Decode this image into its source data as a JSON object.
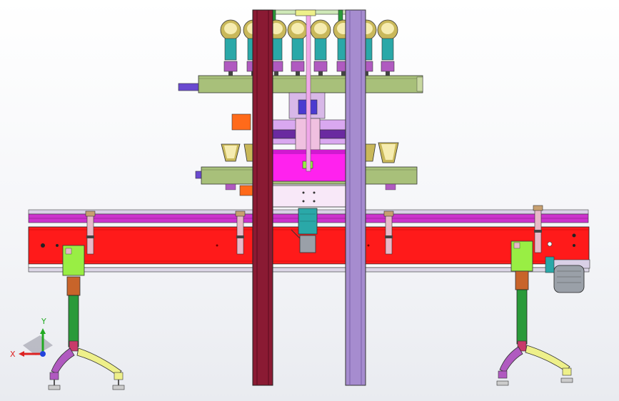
{
  "viewport": {
    "background": "#f4f5f8",
    "colors": {
      "conveyor_red": "#ff1a1a",
      "rail_magenta": "#cc33cc",
      "column_maroon": "#8a1a33",
      "column_purple": "#a68ccf",
      "bracket_olive": "#a8c07a",
      "leg_green": "#2a9a3a",
      "leg_copper": "#c8642a",
      "foot_magenta": "#b05ac0",
      "foot_yellow": "#eef08a",
      "block_green": "#99ee44",
      "panel_magenta": "#ff22ee",
      "motor_teal": "#2aa8a8",
      "cup_gold": "#c9b85a",
      "ram_orange": "#ff6a1a"
    }
  },
  "triad": {
    "x_label": "X",
    "y_label": "Y",
    "x_color": "#dd2222",
    "y_color": "#22aa22",
    "z_color": "#2244dd"
  }
}
